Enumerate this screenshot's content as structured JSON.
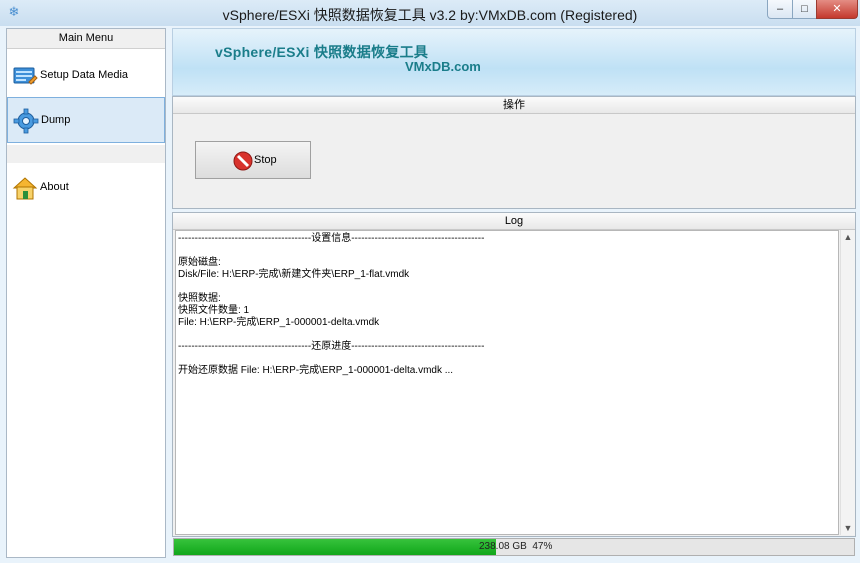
{
  "window": {
    "title": "vSphere/ESXi 快照数据恢复工具 v3.2 by:VMxDB.com (Registered)",
    "controls": {
      "minimize": "‒",
      "maximize": "□",
      "close": "✕"
    }
  },
  "sidebar": {
    "header": "Main Menu",
    "items": [
      {
        "label": "Setup Data Media",
        "icon": "setup-media-icon"
      },
      {
        "label": "Dump",
        "icon": "gear-icon",
        "selected": true
      },
      {
        "label": "About",
        "icon": "home-icon"
      }
    ]
  },
  "banner": {
    "title": "vSphere/ESXi 快照数据恢复工具",
    "subtitle": "VMxDB.com"
  },
  "operations": {
    "header": "操作",
    "stop_label": "Stop"
  },
  "log": {
    "header": "Log",
    "lines": [
      "----------------------------------------设置信息----------------------------------------",
      "",
      "原始磁盘:",
      "Disk/File: H:\\ERP-完成\\新建文件夹\\ERP_1-flat.vmdk",
      "",
      "快照数据:",
      "快照文件数量: 1",
      "File: H:\\ERP-完成\\ERP_1-000001-delta.vmdk",
      "",
      "----------------------------------------还原进度----------------------------------------",
      "",
      "开始还原数据 File: H:\\ERP-完成\\ERP_1-000001-delta.vmdk ..."
    ]
  },
  "progress": {
    "fraction": 0.47,
    "text": "238.08 GB  47%",
    "color": "#1bb026"
  },
  "colors": {
    "banner_text": "#1a7d8a",
    "selection": "#dbeaf7"
  }
}
